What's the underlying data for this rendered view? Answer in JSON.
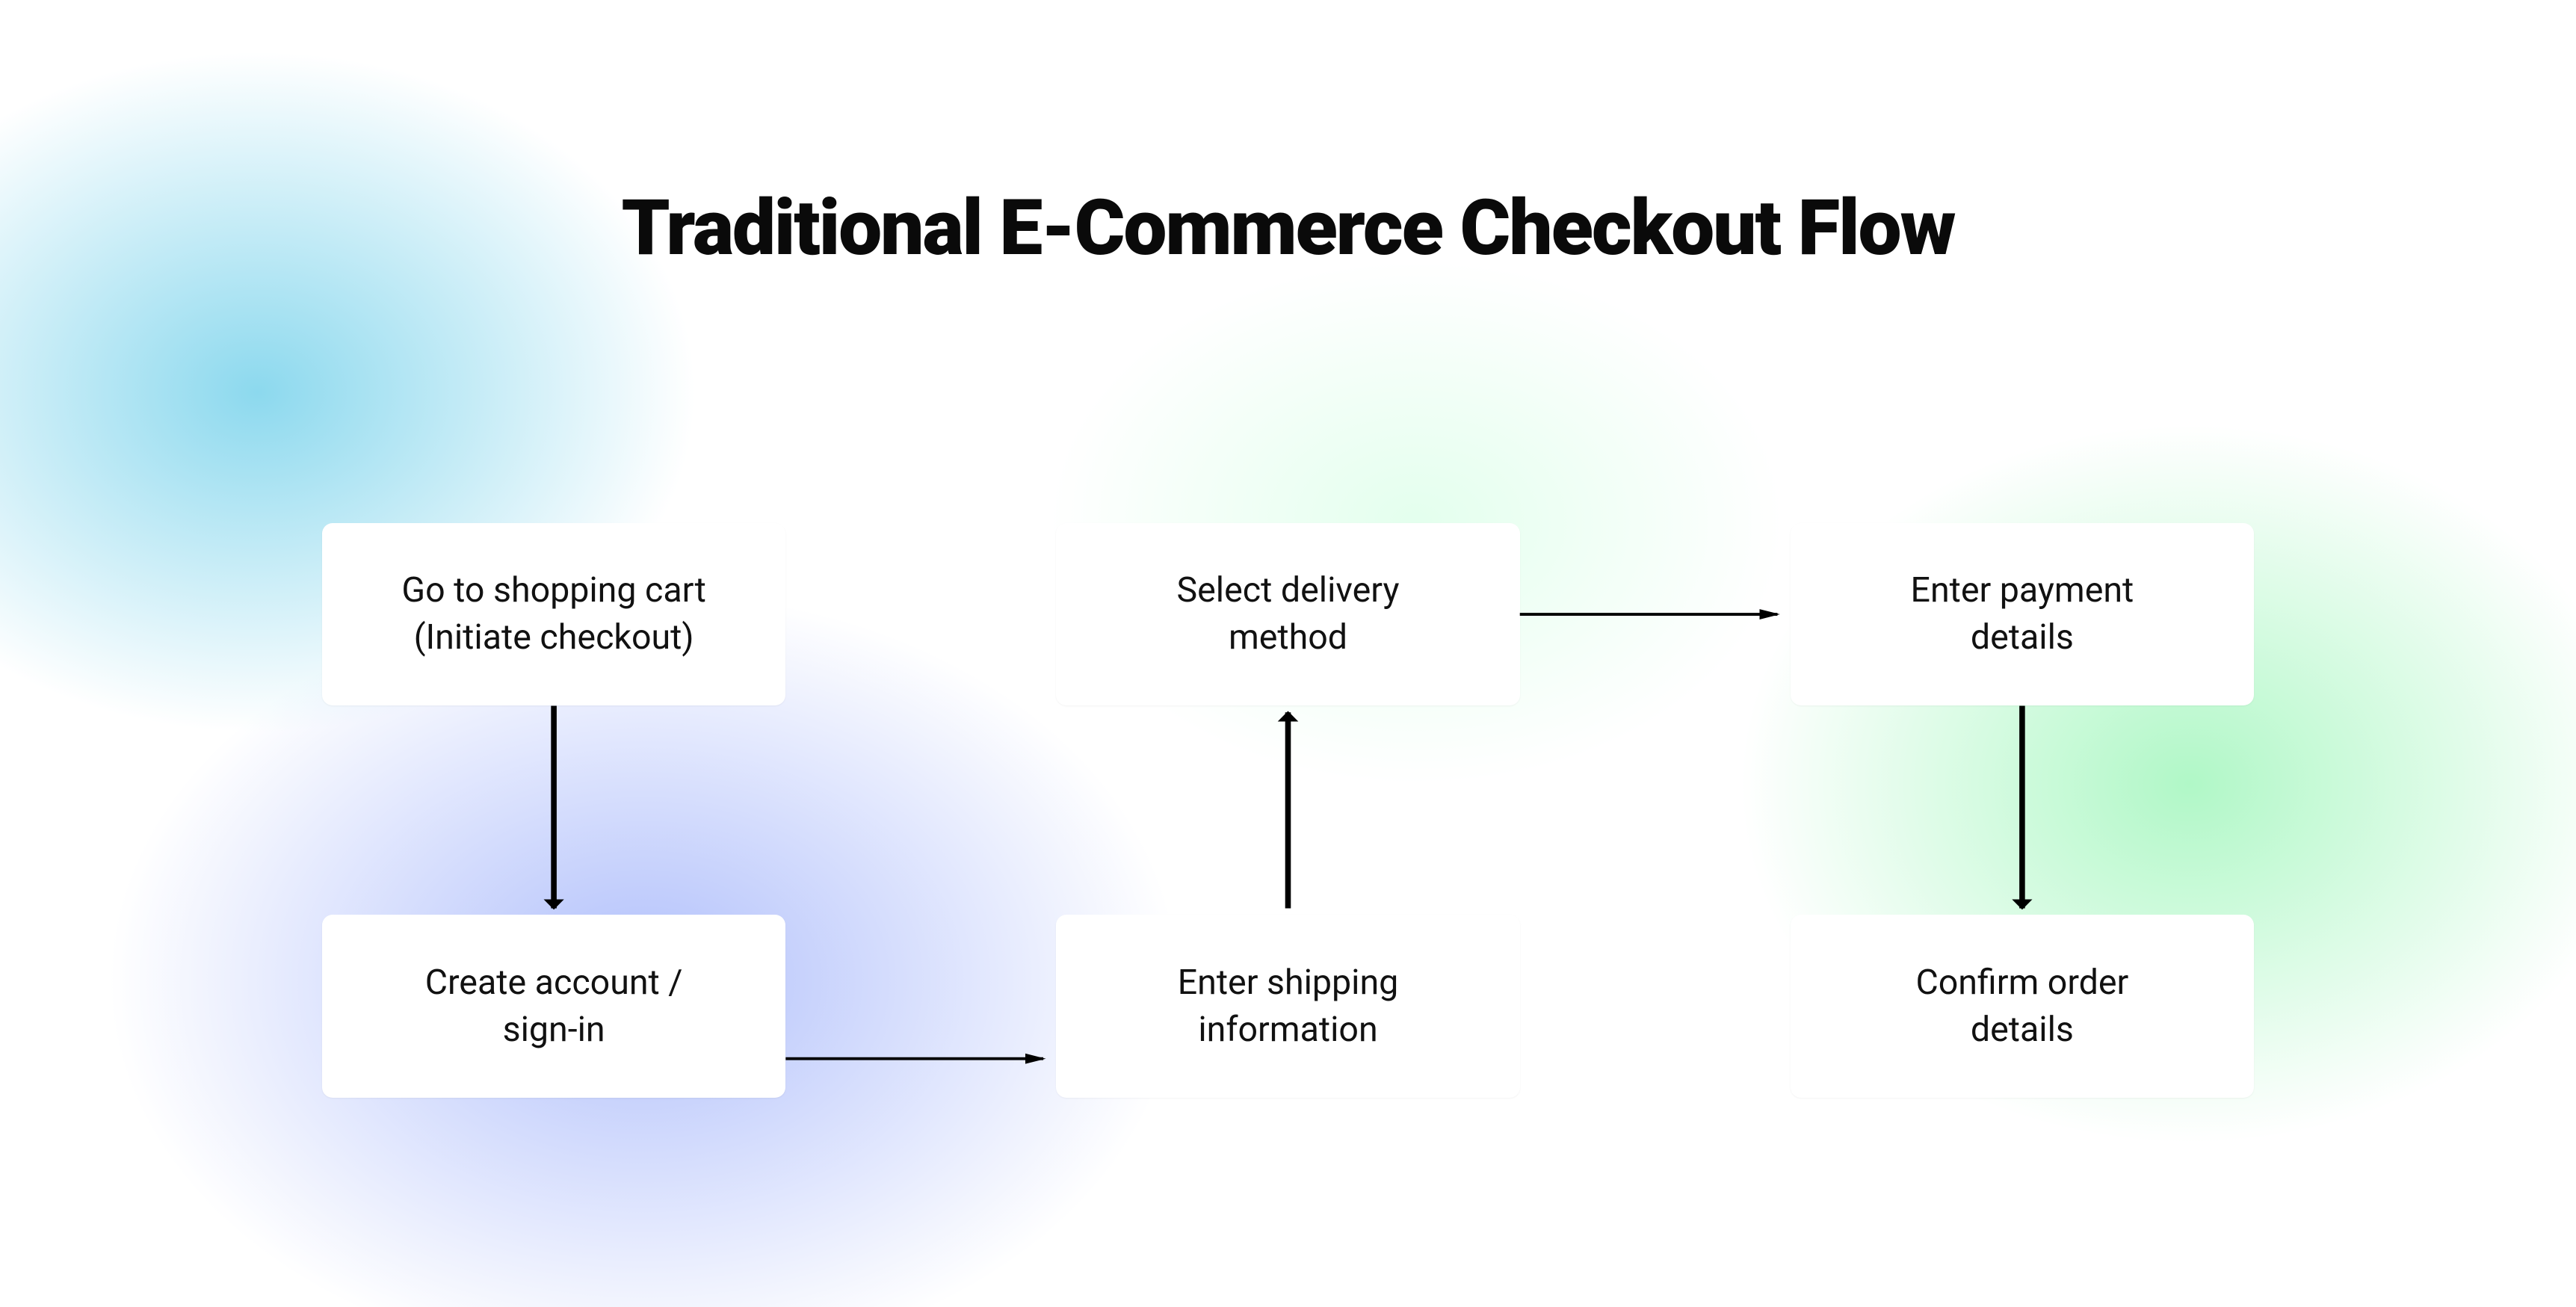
{
  "title": "Traditional E-Commerce Checkout Flow",
  "nodes": {
    "n1": "Go to shopping cart\n(Initiate checkout)",
    "n2": "Create account /\nsign-in",
    "n3": "Enter shipping\ninformation",
    "n4": "Select delivery\nmethod",
    "n5": "Enter payment\ndetails",
    "n6": "Confirm order\ndetails"
  }
}
